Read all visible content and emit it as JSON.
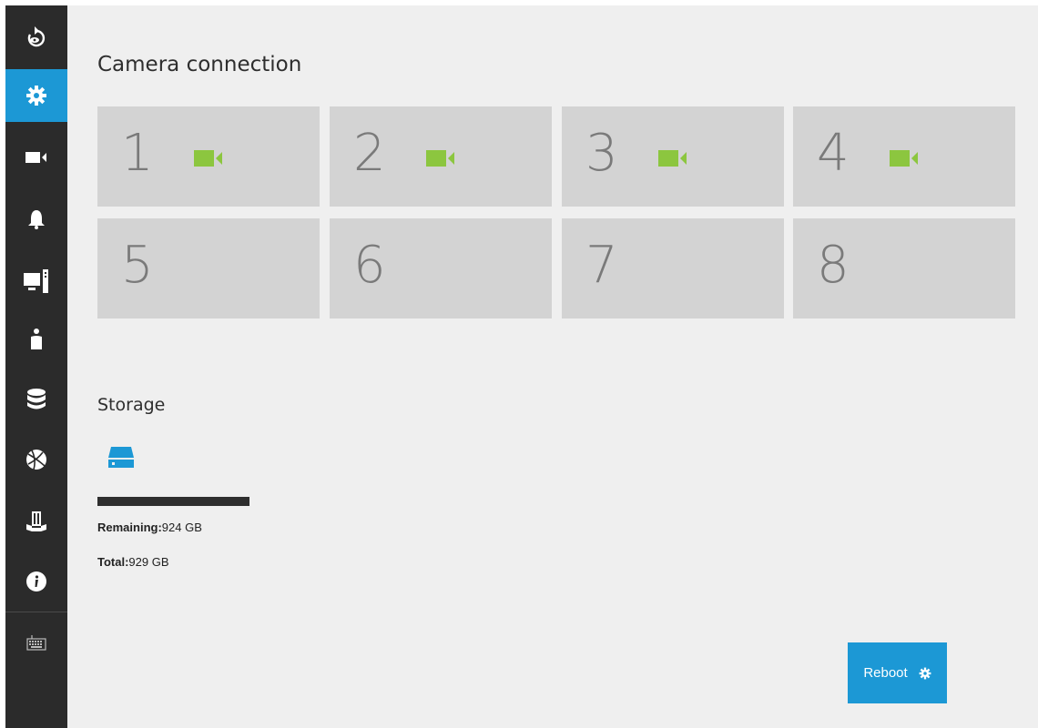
{
  "sidebar": {
    "items": [
      {
        "name": "back-icon"
      },
      {
        "name": "settings-icon",
        "active": true
      },
      {
        "name": "camera-icon"
      },
      {
        "name": "bell-icon"
      },
      {
        "name": "monitor-icon"
      },
      {
        "name": "user-icon"
      },
      {
        "name": "database-icon"
      },
      {
        "name": "globe-icon"
      },
      {
        "name": "tools-icon"
      },
      {
        "name": "info-icon"
      },
      {
        "name": "keyboard-icon"
      }
    ],
    "accent": "#1c98d5"
  },
  "camera_connection": {
    "title": "Camera connection",
    "tiles": [
      {
        "number": "1",
        "connected": true
      },
      {
        "number": "2",
        "connected": true
      },
      {
        "number": "3",
        "connected": true
      },
      {
        "number": "4",
        "connected": true
      },
      {
        "number": "5",
        "connected": false
      },
      {
        "number": "6",
        "connected": false
      },
      {
        "number": "7",
        "connected": false
      },
      {
        "number": "8",
        "connected": false
      }
    ],
    "connected_color": "#8cc63f"
  },
  "storage": {
    "title": "Storage",
    "remaining_label": "Remaining:",
    "remaining_value": "924 GB",
    "total_label": "Total:",
    "total_value": "929 GB",
    "used_fraction": 0.0054,
    "disk_color": "#1c98d5"
  },
  "reboot": {
    "label": "Reboot"
  }
}
